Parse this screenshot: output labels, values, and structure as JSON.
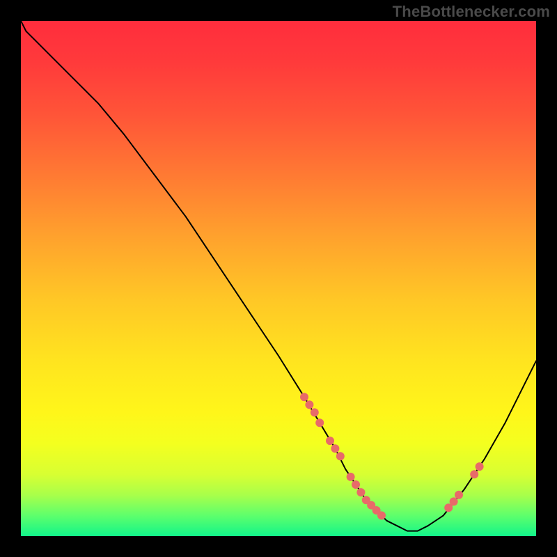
{
  "watermark": "TheBottlenecker.com",
  "chart_data": {
    "type": "line",
    "title": "",
    "xlabel": "",
    "ylabel": "",
    "xlim": [
      0,
      100
    ],
    "ylim": [
      0,
      100
    ],
    "grid": false,
    "x": [
      0,
      1,
      3,
      6,
      10,
      15,
      20,
      26,
      32,
      38,
      44,
      50,
      55,
      58,
      61,
      63,
      65,
      67,
      69,
      71,
      73,
      75,
      77,
      79,
      82,
      86,
      90,
      94,
      97,
      100
    ],
    "y": [
      100,
      98,
      96,
      93,
      89,
      84,
      78,
      70,
      62,
      53,
      44,
      35,
      27,
      22,
      17,
      13,
      10,
      7,
      5,
      3,
      2,
      1,
      1,
      2,
      4,
      9,
      15,
      22,
      28,
      34
    ],
    "markers": {
      "x": [
        55,
        56,
        57,
        58,
        60,
        61,
        62,
        64,
        65,
        66,
        67,
        68,
        69,
        70,
        83,
        84,
        85,
        88,
        89
      ],
      "y": [
        27,
        25.5,
        24,
        22,
        18.5,
        17,
        15.5,
        11.5,
        10,
        8.5,
        7,
        6,
        5,
        4,
        5.5,
        6.7,
        8,
        12,
        13.5
      ]
    },
    "gradient_stops": [
      {
        "pct": 0,
        "hex": "#ff2d3d"
      },
      {
        "pct": 18,
        "hex": "#ff5438"
      },
      {
        "pct": 42,
        "hex": "#ffa22d"
      },
      {
        "pct": 66,
        "hex": "#ffe41f"
      },
      {
        "pct": 88,
        "hex": "#d8ff32"
      },
      {
        "pct": 100,
        "hex": "#12f58a"
      }
    ]
  }
}
